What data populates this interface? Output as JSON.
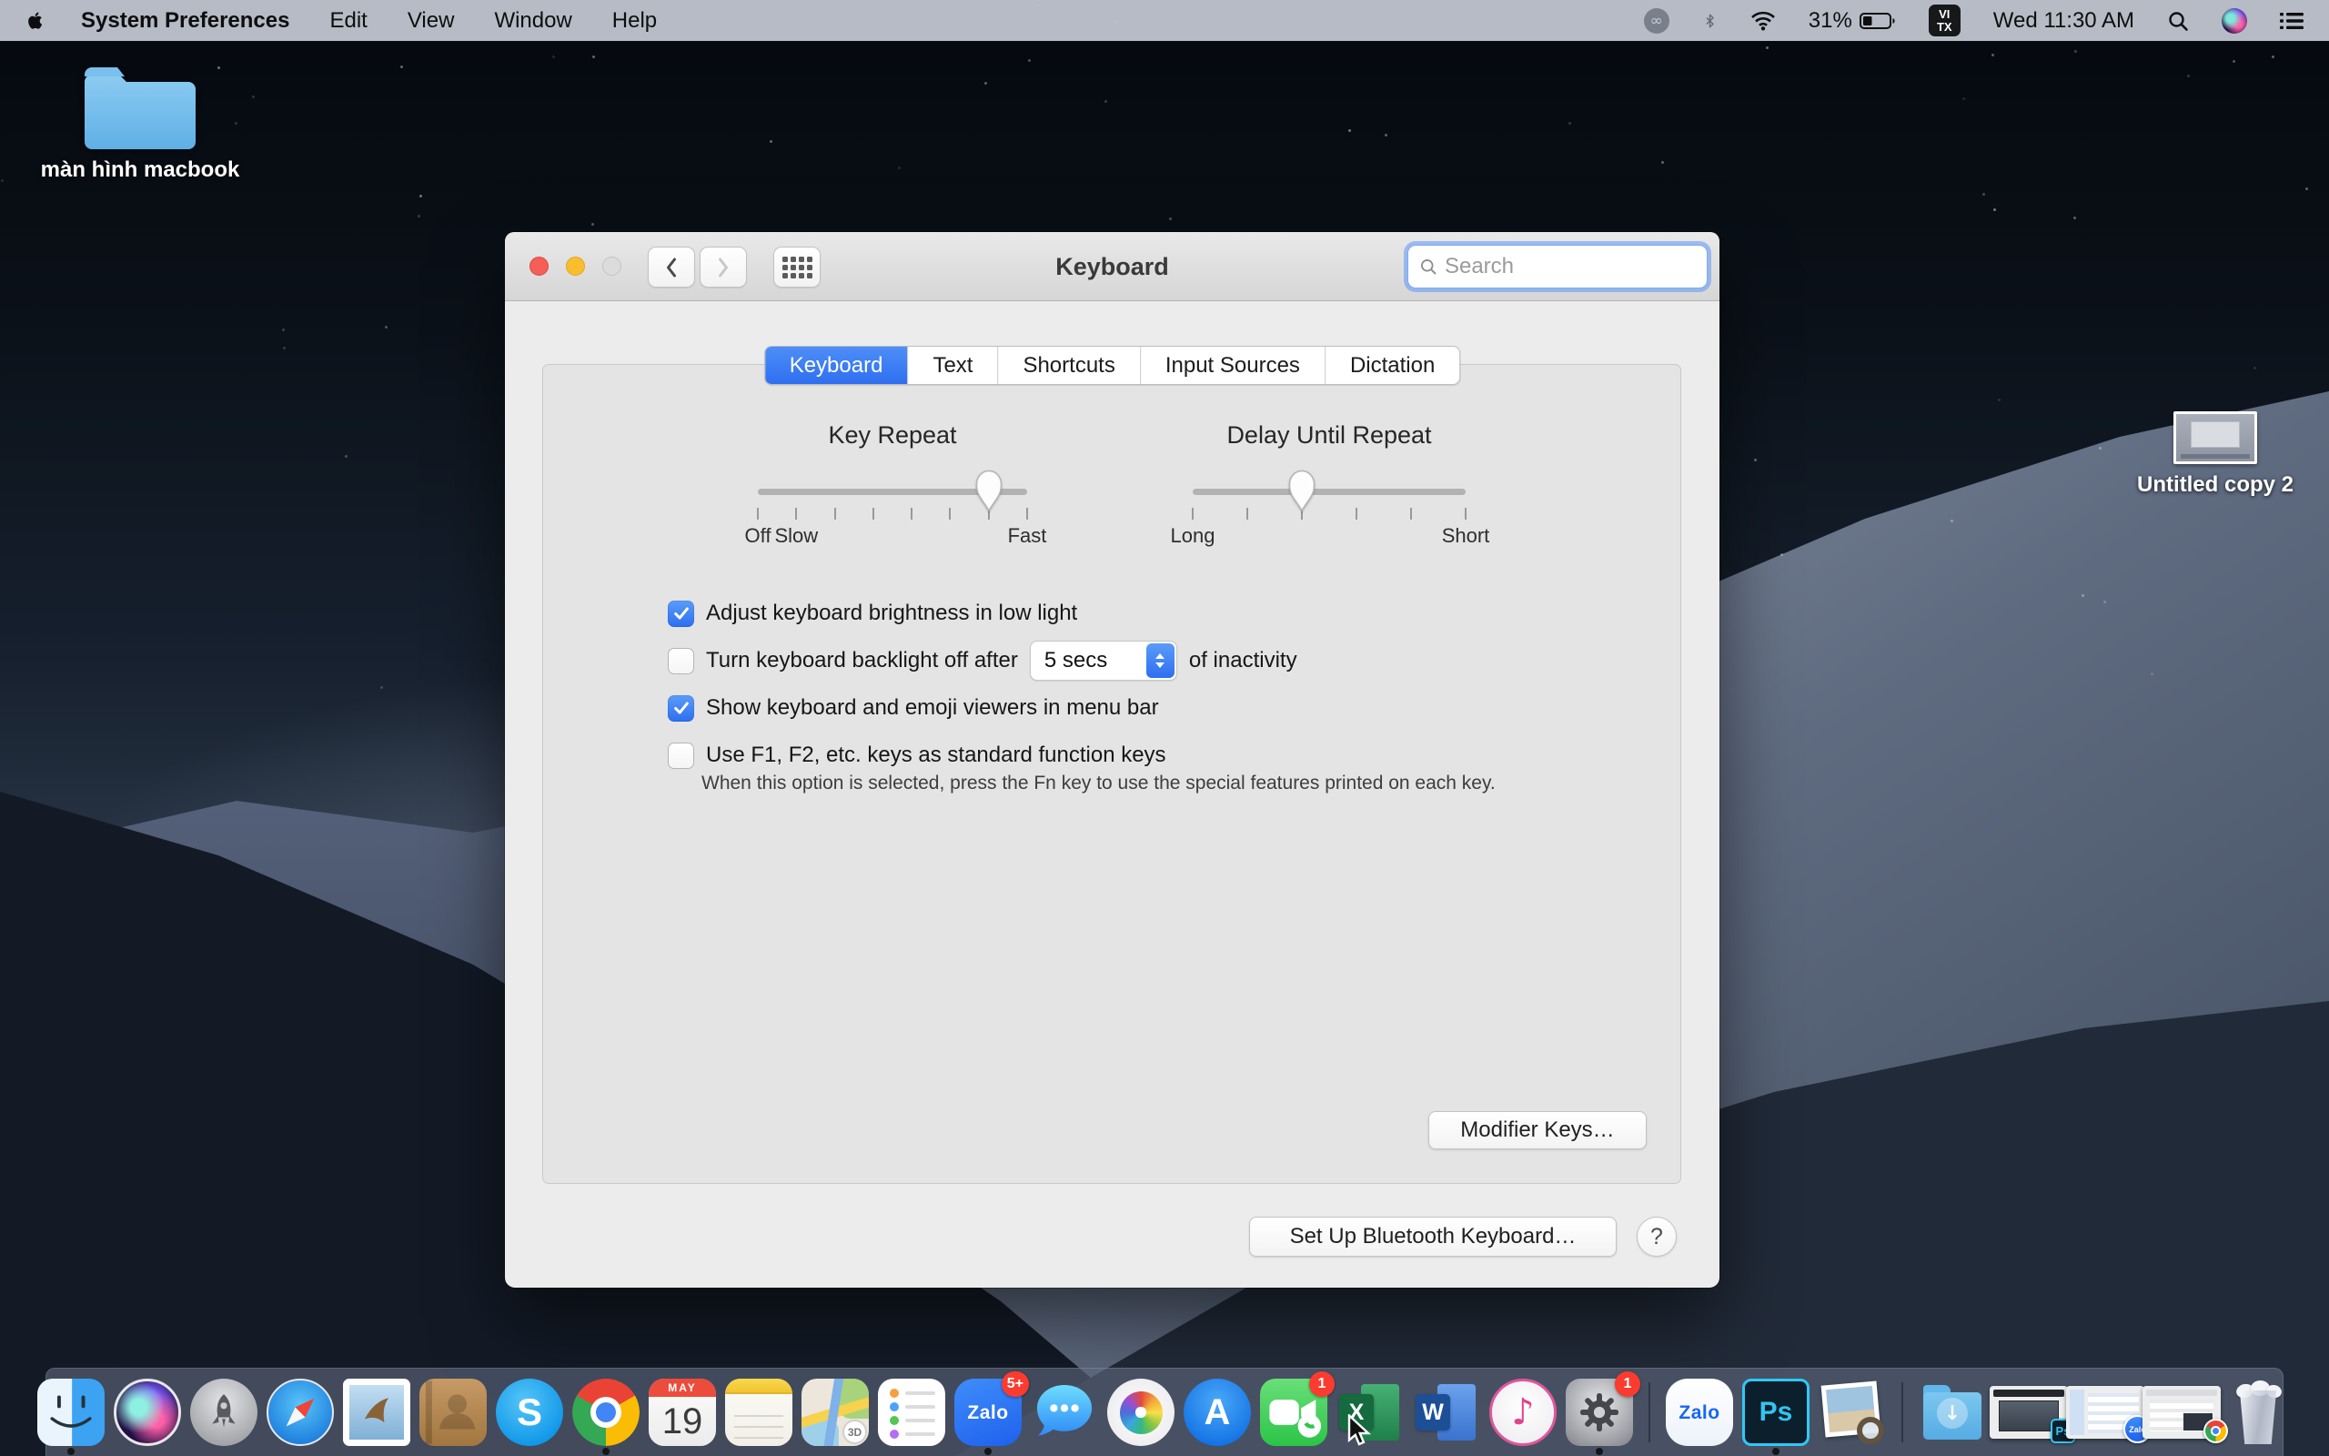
{
  "menu_bar": {
    "app_name": "System Preferences",
    "menus": [
      "Edit",
      "View",
      "Window",
      "Help"
    ],
    "status": {
      "battery": "31%",
      "input_top": "VI",
      "input_bottom": "TX",
      "clock": "Wed 11:30 AM"
    }
  },
  "desktop": {
    "folder_label": "màn hình macbook",
    "file_label": "Untitled copy 2"
  },
  "window": {
    "title": "Keyboard",
    "search_placeholder": "Search",
    "tabs": [
      "Keyboard",
      "Text",
      "Shortcuts",
      "Input Sources",
      "Dictation"
    ],
    "selected_tab": "Keyboard",
    "key_repeat": {
      "title": "Key Repeat",
      "ticks": 8,
      "value": 6,
      "labels": [
        {
          "text": "Off",
          "at": 0
        },
        {
          "text": "Slow",
          "at": 1
        },
        {
          "text": "Fast",
          "at": 7
        }
      ]
    },
    "delay_until_repeat": {
      "title": "Delay Until Repeat",
      "ticks": 6,
      "value": 2,
      "labels": [
        {
          "text": "Long",
          "at": 0
        },
        {
          "text": "Short",
          "at": 5
        }
      ]
    },
    "checkboxes": [
      {
        "label": "Adjust keyboard brightness in low light",
        "checked": true
      },
      {
        "label": "Turn keyboard backlight off after",
        "checked": false,
        "dropdown_value": "5 secs",
        "suffix": "of inactivity"
      },
      {
        "label": "Show keyboard and emoji viewers in menu bar",
        "checked": true
      },
      {
        "label": "Use F1, F2, etc. keys as standard function keys",
        "checked": false,
        "note": "When this option is selected, press the Fn key to use the special features printed on each key."
      }
    ],
    "modifier_keys_button": "Modifier Keys…",
    "bluetooth_button": "Set Up Bluetooth Keyboard…",
    "help_button": "?"
  },
  "dock": {
    "items": [
      {
        "icon": "finder",
        "name": "Finder",
        "running": true
      },
      {
        "icon": "siri",
        "name": "Siri"
      },
      {
        "icon": "launchpad",
        "name": "Launchpad"
      },
      {
        "icon": "safari",
        "name": "Safari"
      },
      {
        "icon": "mail",
        "name": "Mail"
      },
      {
        "icon": "contacts",
        "name": "Contacts"
      },
      {
        "icon": "skype",
        "name": "Skype",
        "glyph": "S"
      },
      {
        "icon": "chrome",
        "name": "Google Chrome",
        "running": true
      },
      {
        "icon": "calendar",
        "name": "Calendar",
        "month": "MAY",
        "day": "19"
      },
      {
        "icon": "notes",
        "name": "Notes"
      },
      {
        "icon": "maps",
        "name": "Maps",
        "glyph": "3D"
      },
      {
        "icon": "reminders",
        "name": "Reminders"
      },
      {
        "icon": "zalo",
        "name": "Zalo",
        "glyph": "Zalo",
        "badge": "5+",
        "running": true
      },
      {
        "icon": "messages",
        "name": "Messages"
      },
      {
        "icon": "photos",
        "name": "Photos"
      },
      {
        "icon": "appstore",
        "name": "App Store",
        "glyph": "A"
      },
      {
        "icon": "facetime",
        "name": "FaceTime",
        "badge": "1"
      },
      {
        "icon": "excel",
        "name": "Microsoft Excel",
        "glyph": "X"
      },
      {
        "icon": "word",
        "name": "Microsoft Word",
        "glyph": "W"
      },
      {
        "icon": "itunes",
        "name": "iTunes",
        "glyph": "♪"
      },
      {
        "icon": "sysprefs",
        "name": "System Preferences",
        "badge": "1",
        "running": true
      },
      {
        "sep": true
      },
      {
        "icon": "zalo-light",
        "name": "Zalo",
        "glyph": "Zalo"
      },
      {
        "icon": "photoshop",
        "name": "Adobe Photoshop",
        "glyph": "Ps",
        "running": true
      },
      {
        "icon": "preview",
        "name": "Preview"
      },
      {
        "sep": true
      },
      {
        "icon": "downloads",
        "name": "Downloads"
      },
      {
        "icon": "min-photoshop",
        "name": "Minimized Photoshop window",
        "glyph": "Ps"
      },
      {
        "icon": "min-zalo",
        "name": "Minimized Zalo window",
        "glyph": "Zalo"
      },
      {
        "icon": "min-chrome",
        "name": "Minimized Chrome window"
      },
      {
        "icon": "trash",
        "name": "Trash"
      }
    ]
  },
  "colors": {
    "accent": "#3878f6",
    "badge_red": "#fb3b30"
  }
}
